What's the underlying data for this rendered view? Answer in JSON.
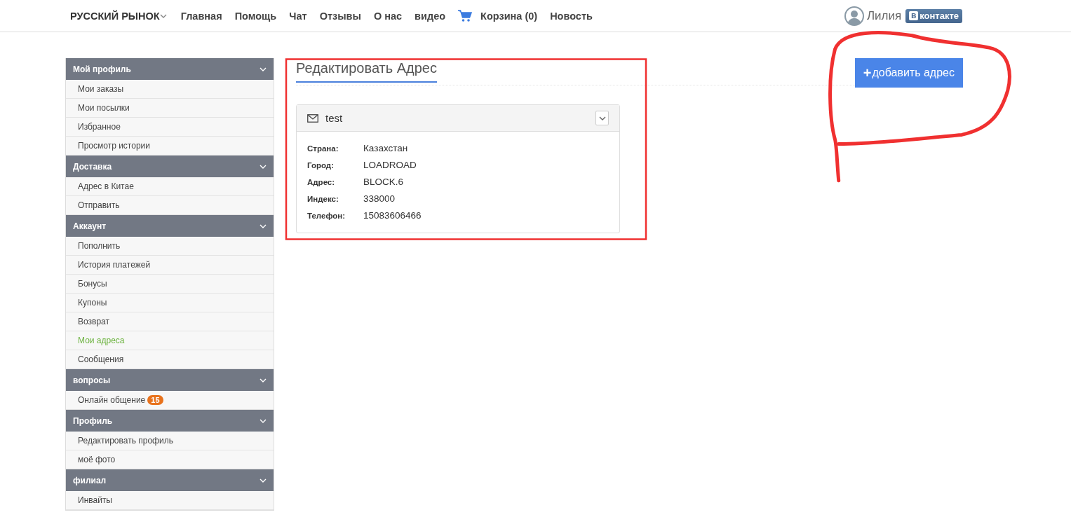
{
  "nav": {
    "brand": "РУССКИЙ РЫНОК",
    "links": [
      {
        "label": "Главная",
        "kind": "link"
      },
      {
        "label": "Помощь",
        "kind": "link"
      },
      {
        "label": "Чат",
        "kind": "link"
      },
      {
        "label": "Отзывы",
        "kind": "link"
      },
      {
        "label": "О нас",
        "kind": "link"
      },
      {
        "label": "видео",
        "kind": "link"
      },
      {
        "label": "Корзина (0)",
        "kind": "cart"
      },
      {
        "label": "Новость",
        "kind": "link"
      }
    ],
    "user": "Лилия",
    "vk": {
      "badge": "в",
      "label": "контакте"
    }
  },
  "sidebar": [
    {
      "title": "Мой профиль",
      "items": [
        {
          "label": "Мои заказы",
          "selected": false
        },
        {
          "label": "Мои посылки",
          "selected": false
        },
        {
          "label": "Избранное",
          "selected": false
        },
        {
          "label": "Просмотр истории",
          "selected": false
        }
      ]
    },
    {
      "title": "Доставка",
      "items": [
        {
          "label": "Адрес в Китае",
          "selected": false
        },
        {
          "label": "Отправить",
          "selected": false
        }
      ]
    },
    {
      "title": "Аккаунт",
      "items": [
        {
          "label": "Пополнить",
          "selected": false
        },
        {
          "label": "История платежей",
          "selected": false
        },
        {
          "label": "Бонусы",
          "selected": false
        },
        {
          "label": "Купоны",
          "selected": false
        },
        {
          "label": "Возврат",
          "selected": false
        },
        {
          "label": "Мои адреса",
          "selected": true
        },
        {
          "label": "Сообщения",
          "selected": false
        }
      ]
    },
    {
      "title": "вопросы",
      "items": [
        {
          "label": "Онлайн общение",
          "selected": false,
          "badge": "15"
        }
      ]
    },
    {
      "title": "Профиль",
      "items": [
        {
          "label": "Редактировать профиль",
          "selected": false
        },
        {
          "label": "моё фото",
          "selected": false
        }
      ]
    },
    {
      "title": "филиал",
      "items": [
        {
          "label": "Инвайты",
          "selected": false
        }
      ]
    }
  ],
  "main": {
    "title": "Редактировать Адрес",
    "add_button": {
      "icon": "+",
      "label": "добавить адрес"
    },
    "address_card": {
      "name": "test",
      "fields": [
        {
          "label": "Страна:",
          "value": "Казахстан"
        },
        {
          "label": "Город:",
          "value": "LOADROAD"
        },
        {
          "label": "Адрес:",
          "value": "BLOCK.6"
        },
        {
          "label": "Индекс:",
          "value": "338000"
        },
        {
          "label": "Телефон:",
          "value": "15083606466"
        }
      ]
    }
  },
  "annotations": [
    {
      "kind": "rectangle"
    },
    {
      "kind": "freehand"
    }
  ]
}
